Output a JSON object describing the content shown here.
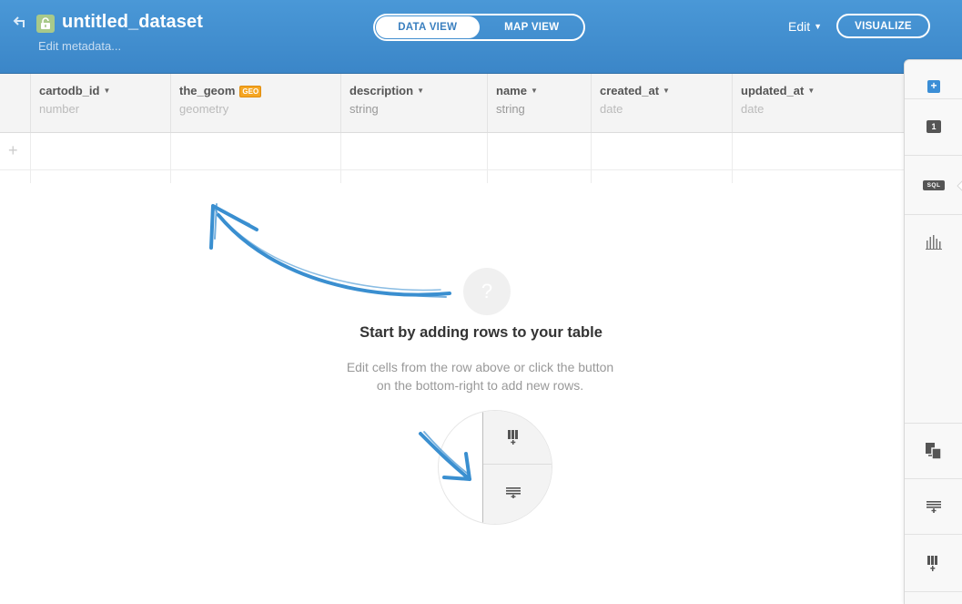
{
  "header": {
    "title": "untitled_dataset",
    "edit_metadata": "Edit metadata...",
    "view_tabs": [
      "DATA VIEW",
      "MAP VIEW"
    ],
    "active_tab": "DATA VIEW",
    "edit_menu": "Edit",
    "visualize_label": "VISUALIZE"
  },
  "table": {
    "columns": [
      {
        "name": "cartodb_id",
        "type": "number"
      },
      {
        "name": "the_geom",
        "type": "geometry",
        "badge": "GEO"
      },
      {
        "name": "description",
        "type": "string"
      },
      {
        "name": "name",
        "type": "string"
      },
      {
        "name": "created_at",
        "type": "date"
      },
      {
        "name": "updated_at",
        "type": "date"
      }
    ],
    "add_row_glyph": "+"
  },
  "empty_state": {
    "icon_glyph": "?",
    "title": "Start by adding rows to your table",
    "line1": "Edit cells from the row above or click the button",
    "line2": "on the bottom-right to add new rows."
  },
  "side_panel": {
    "add_glyph": "+",
    "layer_number": "1",
    "sql_label": "SQL",
    "icons": [
      "add-layer-icon",
      "layer-one-icon",
      "sql-icon",
      "chart-icon",
      "merge-icon",
      "add-row-icon",
      "add-column-icon"
    ]
  },
  "colors": {
    "header_blue": "#3b86c8",
    "arrow_blue": "#3a8fd0",
    "geo_badge": "#f5a623",
    "lock_green": "#a8c98a"
  }
}
